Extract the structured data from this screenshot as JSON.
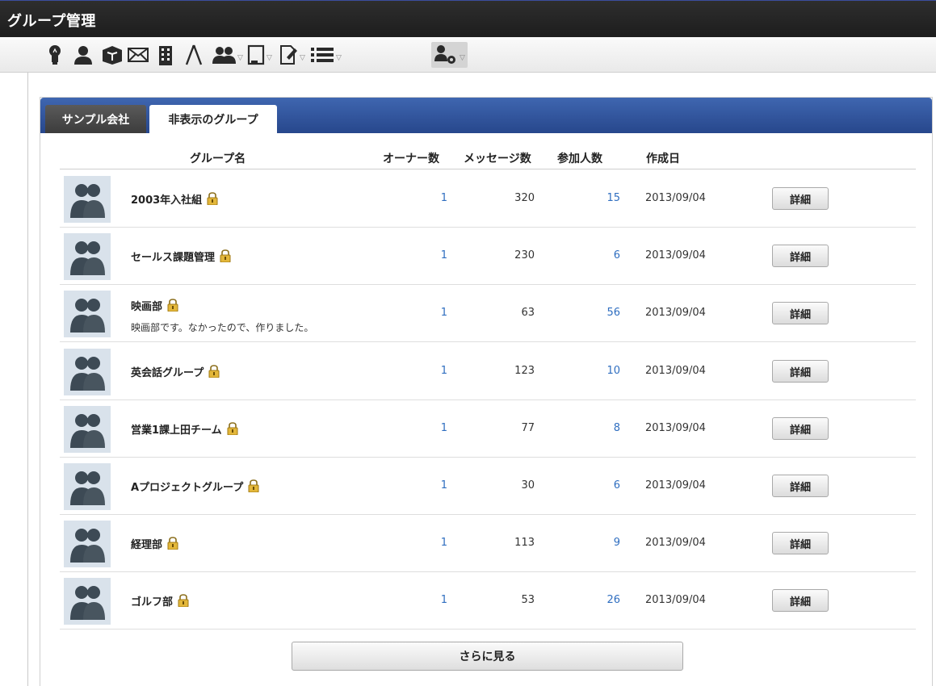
{
  "window": {
    "title": "グループ管理"
  },
  "toolbar": {
    "items": [
      {
        "icon": "lightbulb-icon"
      },
      {
        "icon": "user-icon"
      },
      {
        "icon": "box-icon"
      },
      {
        "icon": "mail-icon"
      },
      {
        "icon": "building-icon"
      },
      {
        "icon": "compass-icon"
      },
      {
        "icon": "users-icon",
        "dropdown": true
      },
      {
        "icon": "device-icon",
        "dropdown": true
      },
      {
        "icon": "document-edit-icon",
        "dropdown": true
      },
      {
        "icon": "list-icon",
        "dropdown": true
      },
      {
        "icon": "user-settings-icon",
        "dropdown": true,
        "active": true
      }
    ],
    "dropdown_glyph": "▽"
  },
  "tabs": [
    {
      "label": "サンプル会社",
      "active": false
    },
    {
      "label": "非表示のグループ",
      "active": true
    }
  ],
  "table": {
    "headers": {
      "name": "グループ名",
      "owners": "オーナー数",
      "messages": "メッセージ数",
      "members": "参加人数",
      "created": "作成日"
    },
    "rows": [
      {
        "name": "2003年入社組",
        "desc": "",
        "owners": "1",
        "messages": "320",
        "members": "15",
        "created": "2013/09/04",
        "action": "詳細"
      },
      {
        "name": "セールス課題管理",
        "desc": "",
        "owners": "1",
        "messages": "230",
        "members": "6",
        "created": "2013/09/04",
        "action": "詳細"
      },
      {
        "name": "映画部",
        "desc": "映画部です。なかったので、作りました。",
        "owners": "1",
        "messages": "63",
        "members": "56",
        "created": "2013/09/04",
        "action": "詳細"
      },
      {
        "name": "英会話グループ",
        "desc": "",
        "owners": "1",
        "messages": "123",
        "members": "10",
        "created": "2013/09/04",
        "action": "詳細"
      },
      {
        "name": "営業1課上田チーム",
        "desc": "",
        "owners": "1",
        "messages": "77",
        "members": "8",
        "created": "2013/09/04",
        "action": "詳細"
      },
      {
        "name": "Aプロジェクトグループ",
        "desc": "",
        "owners": "1",
        "messages": "30",
        "members": "6",
        "created": "2013/09/04",
        "action": "詳細"
      },
      {
        "name": "経理部",
        "desc": "",
        "owners": "1",
        "messages": "113",
        "members": "9",
        "created": "2013/09/04",
        "action": "詳細"
      },
      {
        "name": "ゴルフ部",
        "desc": "",
        "owners": "1",
        "messages": "53",
        "members": "26",
        "created": "2013/09/04",
        "action": "詳細"
      }
    ]
  },
  "more_button": "さらに見る",
  "colors": {
    "tab_bar": "#3355a0",
    "link": "#2f6ec0",
    "titlebar": "#262626"
  }
}
